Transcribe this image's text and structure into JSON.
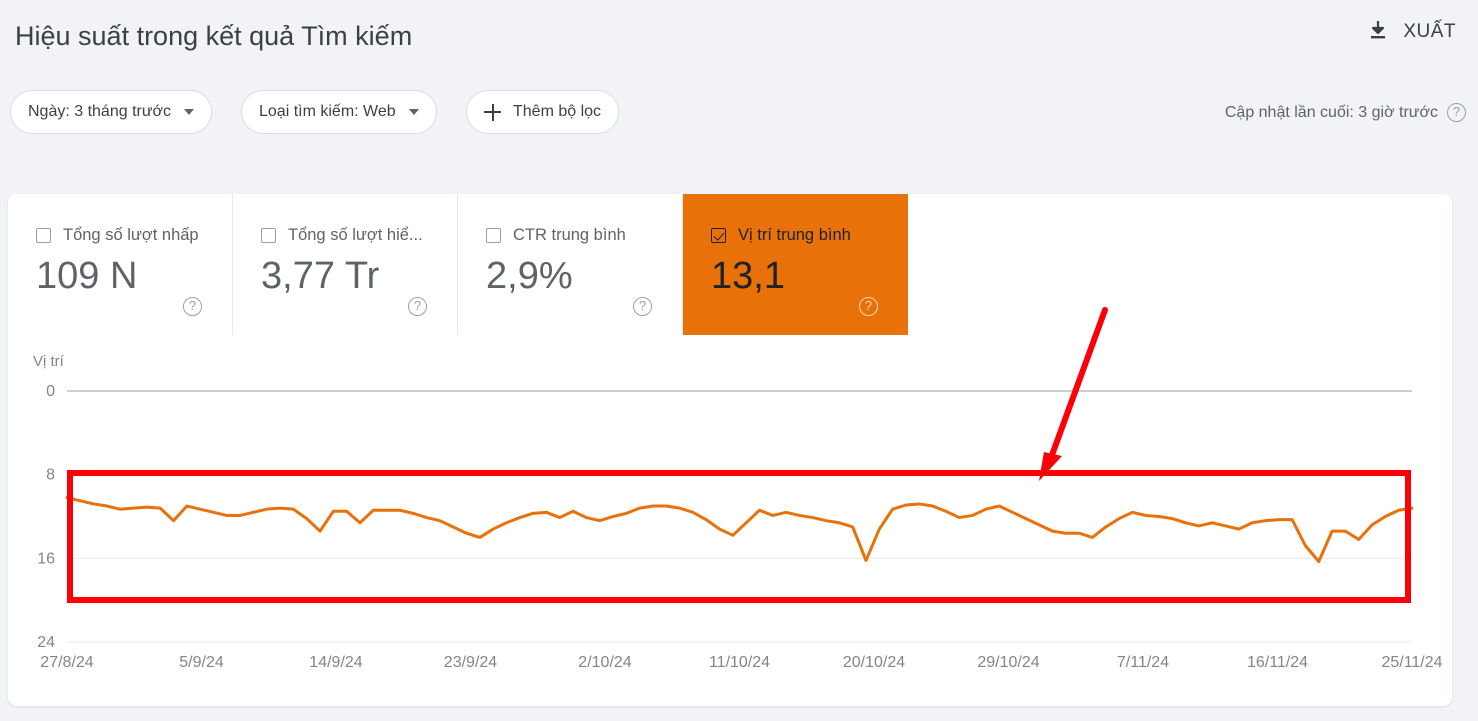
{
  "header": {
    "title": "Hiệu suất trong kết quả Tìm kiếm",
    "export_label": "XUẤT",
    "export_icon": "download-icon"
  },
  "filters": {
    "date_chip": "Ngày: 3 tháng trước",
    "search_type_chip": "Loại tìm kiếm: Web",
    "add_filter_chip": "Thêm bộ lọc",
    "last_updated": "Cập nhật lần cuối: 3 giờ trước"
  },
  "metrics": [
    {
      "label": "Tổng số lượt nhấp",
      "value": "109 N",
      "checked": false
    },
    {
      "label": "Tổng số lượt hiể...",
      "value": "3,77 Tr",
      "checked": false
    },
    {
      "label": "CTR trung bình",
      "value": "2,9%",
      "checked": false
    },
    {
      "label": "Vị trí trung bình",
      "value": "13,1",
      "checked": true
    }
  ],
  "colors": {
    "accent_orange": "#e8710a",
    "line_orange": "#e8710a",
    "annotation_red": "#fb0007",
    "page_background": "#f1f3f6",
    "panel_background": "#ffffff",
    "text_primary": "#3c4043",
    "text_secondary": "#5f6368",
    "gridline": "#e8eaed"
  },
  "chart_data": {
    "type": "line",
    "title": "",
    "xlabel": "",
    "ylabel": "Vị trí",
    "ylim": [
      0,
      24
    ],
    "y_inverted": true,
    "yticks": [
      "0",
      "8",
      "16",
      "24"
    ],
    "ytick_values": [
      0,
      8,
      16,
      24
    ],
    "grid": true,
    "legend": "none",
    "series": [
      {
        "name": "Vị trí trung bình",
        "color": "#e8710a",
        "values": [
          10.2,
          10.5,
          10.8,
          11.0,
          11.3,
          11.2,
          11.1,
          11.2,
          12.4,
          11.0,
          11.3,
          11.6,
          11.9,
          11.9,
          11.6,
          11.3,
          11.2,
          11.3,
          12.2,
          13.4,
          11.5,
          11.5,
          12.6,
          11.4,
          11.4,
          11.4,
          11.7,
          12.1,
          12.4,
          13.0,
          13.6,
          14.0,
          13.2,
          12.6,
          12.1,
          11.7,
          11.6,
          12.1,
          11.5,
          12.1,
          12.4,
          12.0,
          11.7,
          11.2,
          11.0,
          11.0,
          11.2,
          11.6,
          12.3,
          13.2,
          13.8,
          12.6,
          11.4,
          11.9,
          11.6,
          11.9,
          12.1,
          12.4,
          12.6,
          13.0,
          16.2,
          13.2,
          11.3,
          10.9,
          10.8,
          11.0,
          11.5,
          12.1,
          11.9,
          11.3,
          11.0,
          11.6,
          12.2,
          12.8,
          13.4,
          13.6,
          13.6,
          14.0,
          13.0,
          12.2,
          11.6,
          11.9,
          12.0,
          12.2,
          12.6,
          12.9,
          12.6,
          12.9,
          13.2,
          12.6,
          12.4,
          12.3,
          12.3,
          14.8,
          16.3,
          13.4,
          13.4,
          14.2,
          12.8,
          12.0,
          11.4,
          11.2
        ]
      }
    ],
    "xticks": [
      "27/8/24",
      "5/9/24",
      "14/9/24",
      "23/9/24",
      "2/10/24",
      "11/10/24",
      "20/10/24",
      "29/10/24",
      "7/11/24",
      "16/11/24",
      "25/11/24"
    ]
  },
  "annotations": {
    "highlight_box": "red-rectangle-around-position-line",
    "arrow": "red-arrow-pointing-to-chart"
  }
}
